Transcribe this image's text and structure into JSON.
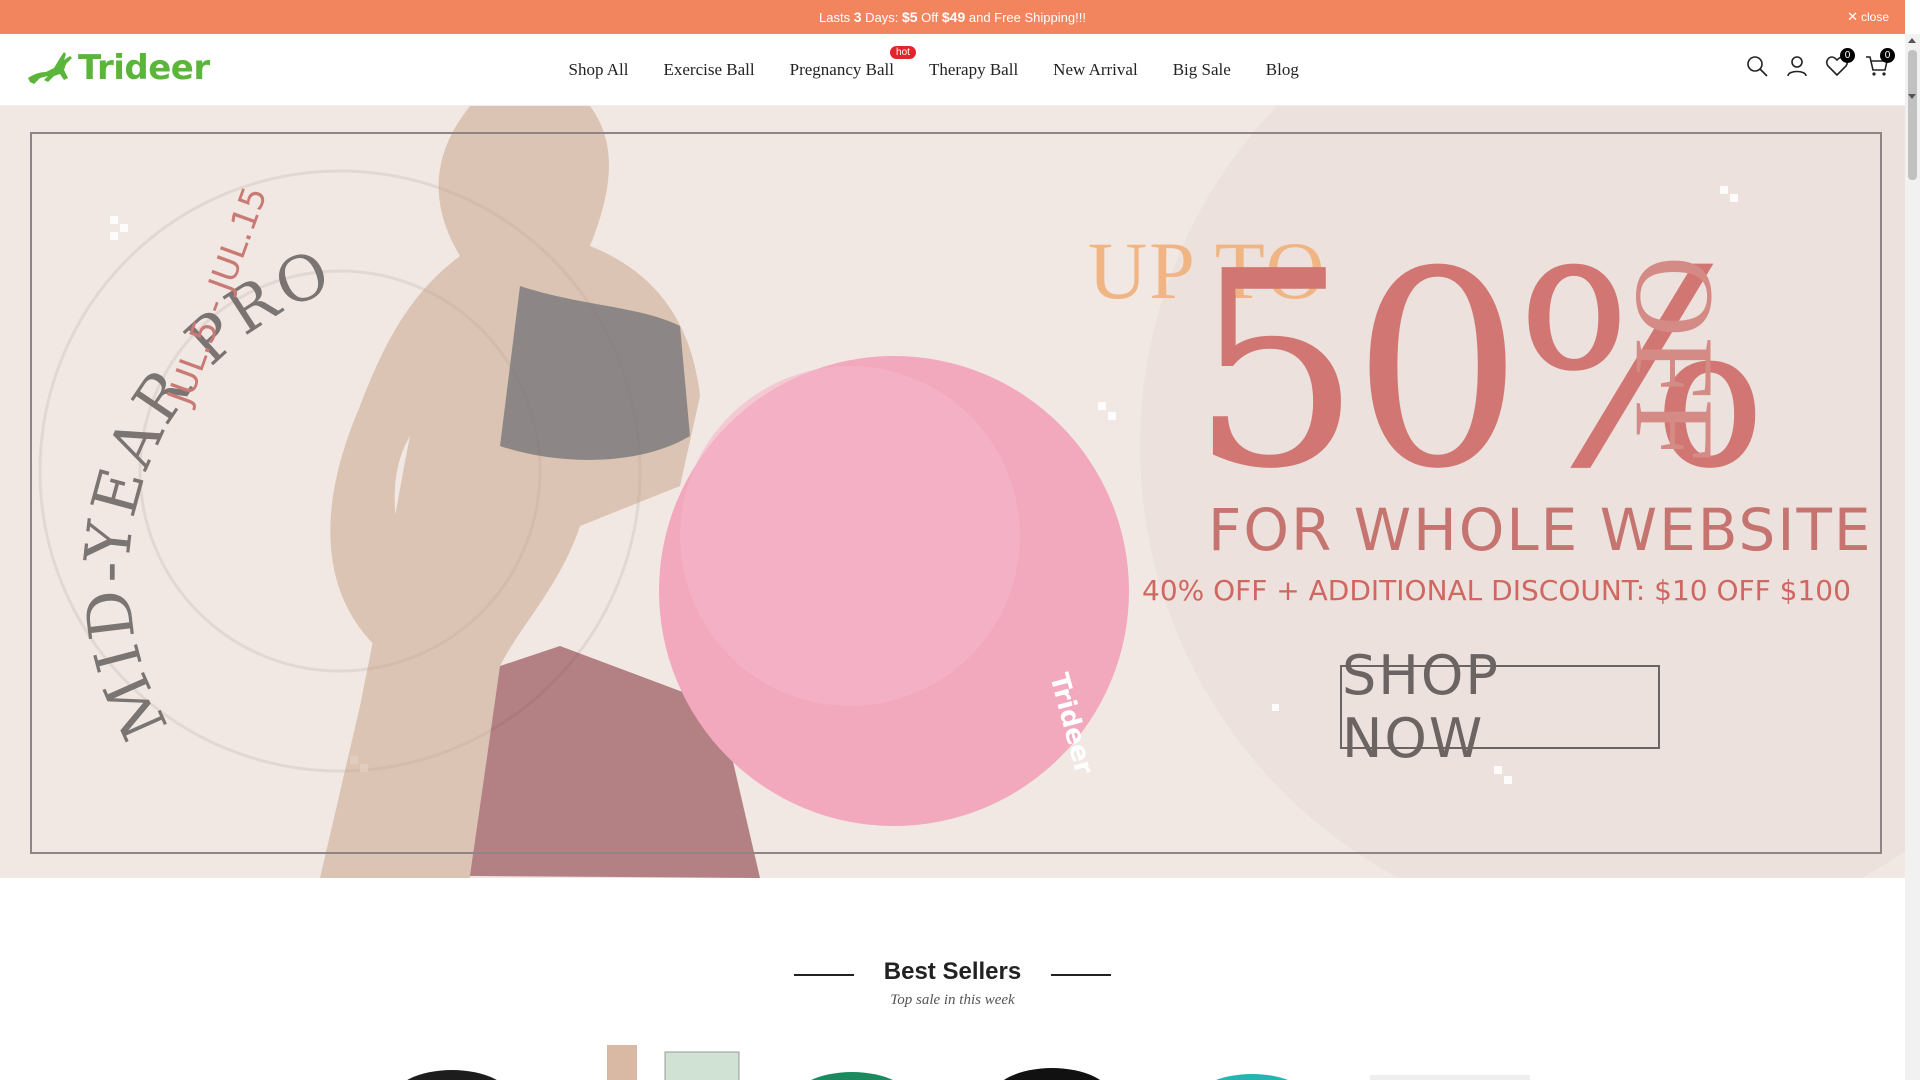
{
  "announcement": {
    "prefix": "Lasts ",
    "days": "3",
    "days_suffix": " Days: ",
    "discount": "$5",
    "off": " Off ",
    "threshold": "$49",
    "suffix": " and Free Shipping!!!",
    "close_label": "close"
  },
  "brand": {
    "name": "Trideer",
    "color": "#5ab53a"
  },
  "nav": {
    "items": [
      {
        "label": "Shop All"
      },
      {
        "label": "Exercise Ball"
      },
      {
        "label": "Pregnancy Ball",
        "badge": "hot"
      },
      {
        "label": "Therapy Ball"
      },
      {
        "label": "New Arrival"
      },
      {
        "label": "Big Sale"
      },
      {
        "label": "Blog"
      }
    ]
  },
  "tools": {
    "search_icon": "search-icon",
    "account_icon": "user-icon",
    "wishlist_count": "0",
    "cart_count": "0"
  },
  "hero": {
    "arc_text": "MID-YEAR PRO",
    "dates": "JUL.5 - JUL.15",
    "up_to": "UP TO",
    "percent": "50%",
    "off": "OFF",
    "whole": "FOR WHOLE WEBSITE",
    "discount": "40% OFF + ADDITIONAL DISCOUNT: $10 OFF $100",
    "cta": "SHOP NOW",
    "ball_brand": "Trideer"
  },
  "best_sellers": {
    "title": "Best Sellers",
    "subtitle": "Top sale in this week"
  },
  "colors": {
    "announce_bg": "#f2855e",
    "hero_bg": "#f1e8e3",
    "accent_pink": "#d17673",
    "hot_badge": "#e2242d"
  }
}
